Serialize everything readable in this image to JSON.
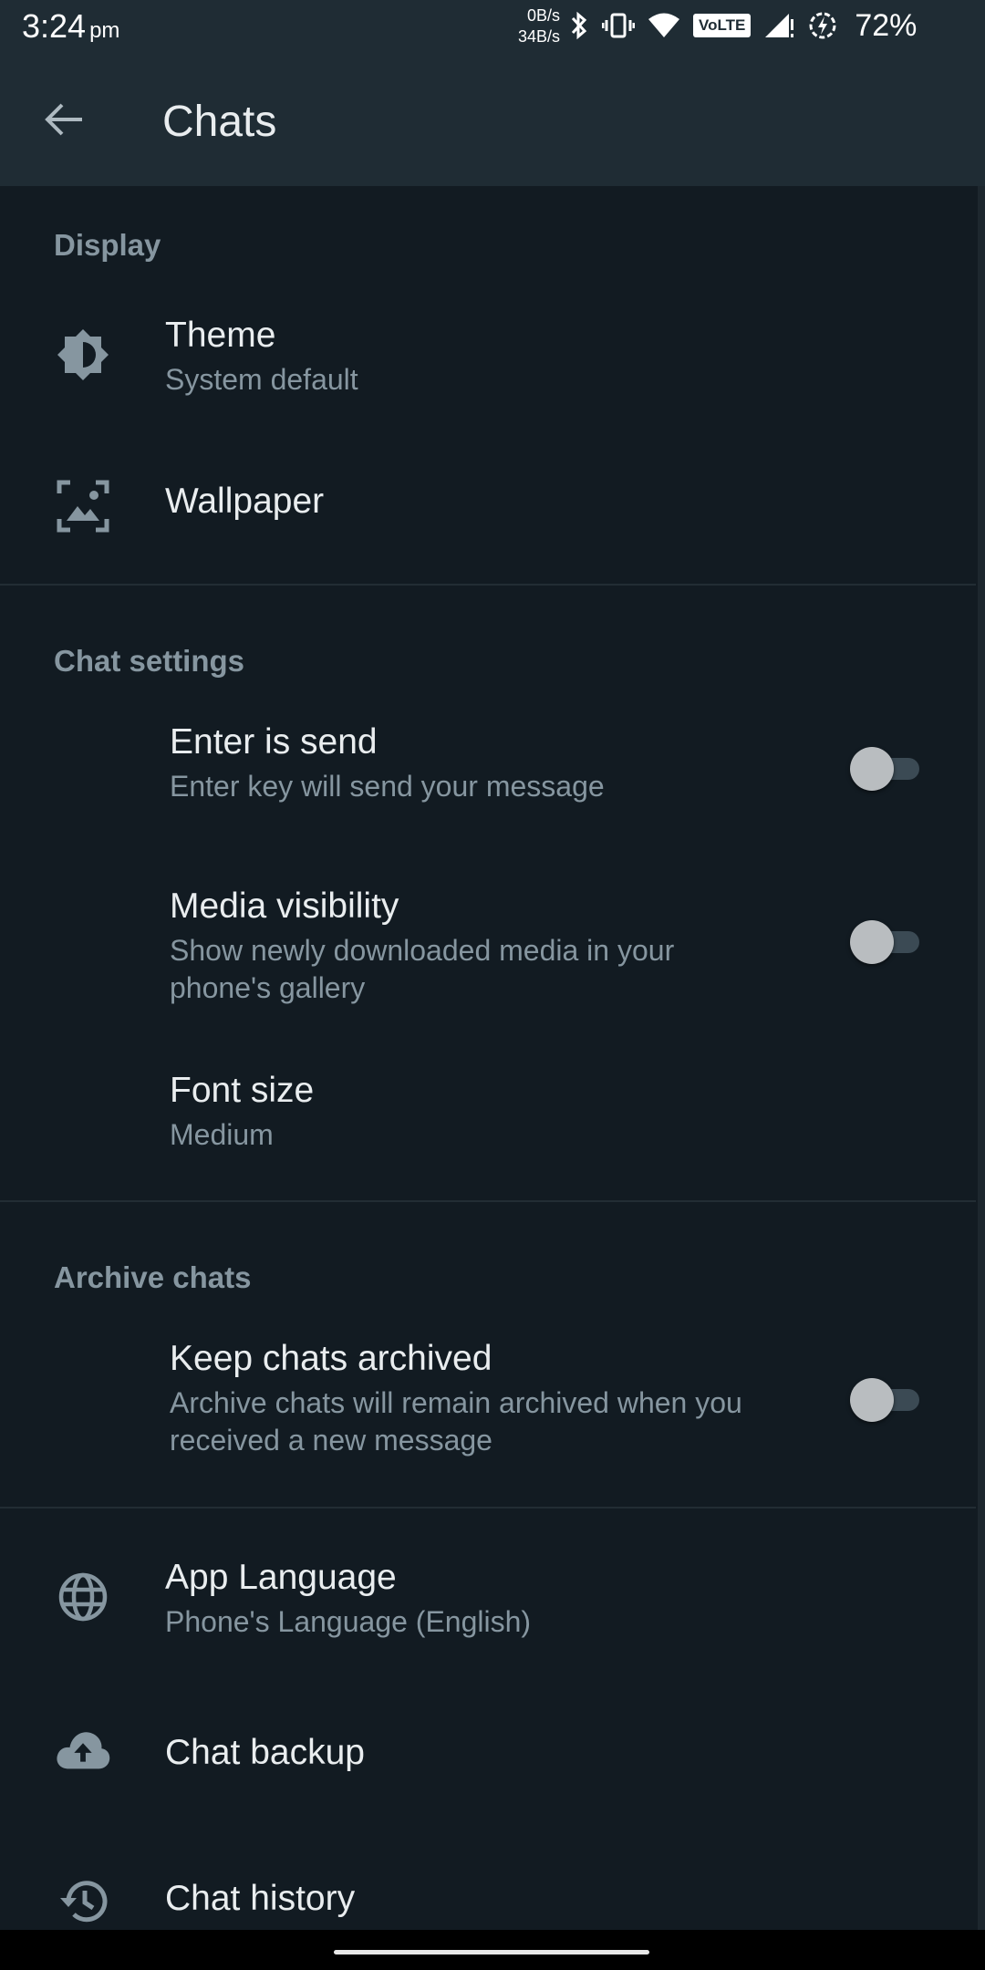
{
  "status": {
    "time": "3:24",
    "ampm": "pm",
    "net_up": "0B/s",
    "net_down": "34B/s",
    "volte": "VoLTE",
    "battery": "72%"
  },
  "appbar": {
    "title": "Chats",
    "back_icon": "arrow-left-icon"
  },
  "sections": {
    "display": {
      "header": "Display",
      "theme": {
        "title": "Theme",
        "subtitle": "System default",
        "icon": "brightness-icon"
      },
      "wallpaper": {
        "title": "Wallpaper",
        "icon": "wallpaper-icon"
      }
    },
    "chat_settings": {
      "header": "Chat settings",
      "enter_is_send": {
        "title": "Enter is send",
        "subtitle": "Enter key will send your message",
        "enabled": false
      },
      "media_visibility": {
        "title": "Media visibility",
        "subtitle": "Show newly downloaded media in your phone's gallery",
        "enabled": false
      },
      "font_size": {
        "title": "Font size",
        "subtitle": "Medium"
      }
    },
    "archive": {
      "header": "Archive chats",
      "keep_archived": {
        "title": "Keep chats archived",
        "subtitle": "Archive chats will remain archived when you received a new message",
        "enabled": false
      }
    },
    "other": {
      "app_language": {
        "title": "App Language",
        "subtitle": "Phone's Language (English)",
        "icon": "globe-icon"
      },
      "chat_backup": {
        "title": "Chat backup",
        "icon": "cloud-upload-icon"
      },
      "chat_history": {
        "title": "Chat history",
        "icon": "history-icon"
      }
    }
  },
  "colors": {
    "background": "#121b22",
    "appbar": "#1f2c34",
    "primary_text": "#e9edef",
    "secondary_text": "#8696a0"
  }
}
